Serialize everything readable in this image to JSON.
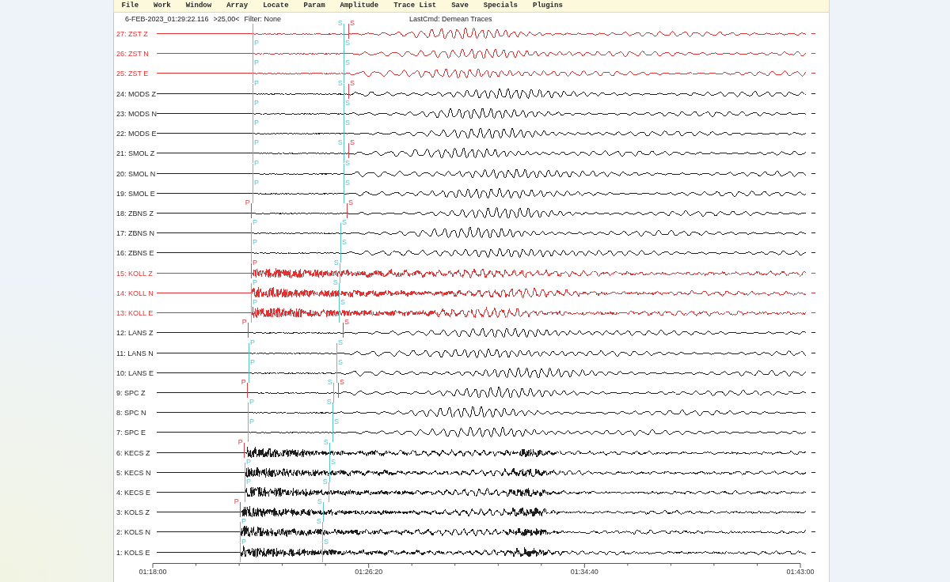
{
  "menu": [
    "File",
    "Work",
    "Window",
    "Array",
    "Locate",
    "Param",
    "Amplitude",
    "Trace List",
    "Save",
    "Specials",
    "Plugins"
  ],
  "header": {
    "event_time": "6-FEB-2023_01:29:22.116",
    "scale": ">25,00<",
    "filter": "Filter: None",
    "last_command": "LastCmd: Demean Traces"
  },
  "traces": [
    {
      "label": "27: ZST Z",
      "color": "#e03232",
      "picks": [
        {
          "kind": "p_theoretical"
        },
        {
          "kind": "s_theoretical",
          "phase": "S"
        },
        {
          "kind": "s_picked",
          "phase": "S"
        }
      ]
    },
    {
      "label": "26: ZST N",
      "color": "#e03232",
      "picks": [
        {
          "kind": "p_theoretical",
          "phase": "P"
        },
        {
          "kind": "s_theoretical",
          "phase": "S"
        }
      ]
    },
    {
      "label": "25: ZST E",
      "color": "#e03232",
      "picks": [
        {
          "kind": "p_theoretical",
          "phase": "P"
        },
        {
          "kind": "s_theoretical",
          "phase": "S"
        }
      ]
    },
    {
      "label": "24: MODS Z",
      "color": "#1e1e1e",
      "picks": [
        {
          "kind": "p_theoretical",
          "phase": "P"
        },
        {
          "kind": "s_theoretical",
          "phase": "S"
        },
        {
          "kind": "s_picked",
          "phase": "S"
        }
      ]
    },
    {
      "label": "23: MODS N",
      "color": "#1e1e1e",
      "picks": [
        {
          "kind": "p_theoretical",
          "phase": "P"
        },
        {
          "kind": "s_theoretical",
          "phase": "S"
        }
      ]
    },
    {
      "label": "22: MODS E",
      "color": "#1e1e1e",
      "picks": [
        {
          "kind": "p_theoretical",
          "phase": "P"
        },
        {
          "kind": "s_theoretical",
          "phase": "S"
        }
      ]
    },
    {
      "label": "21: SMOL Z",
      "color": "#1e1e1e",
      "picks": [
        {
          "kind": "p_theoretical",
          "phase": "P"
        },
        {
          "kind": "s_theoretical",
          "phase": "S"
        },
        {
          "kind": "s_picked",
          "phase": "S"
        }
      ]
    },
    {
      "label": "20: SMOL N",
      "color": "#1e1e1e",
      "picks": [
        {
          "kind": "p_theoretical",
          "phase": "P"
        },
        {
          "kind": "s_theoretical",
          "phase": "S"
        }
      ]
    },
    {
      "label": "19: SMOL E",
      "color": "#1e1e1e",
      "picks": [
        {
          "kind": "p_theoretical",
          "phase": "P"
        },
        {
          "kind": "s_theoretical",
          "phase": "S"
        }
      ]
    },
    {
      "label": "18: ZBNS Z",
      "color": "#1e1e1e",
      "picks": [
        {
          "kind": "p_picked",
          "phase": "P"
        },
        {
          "kind": "s_picked",
          "phase": "S"
        }
      ]
    },
    {
      "label": "17: ZBNS N",
      "color": "#1e1e1e",
      "picks": [
        {
          "kind": "p_theoretical",
          "phase": "P"
        },
        {
          "kind": "s_theoretical",
          "phase": "S"
        }
      ]
    },
    {
      "label": "16: ZBNS E",
      "color": "#1e1e1e",
      "picks": [
        {
          "kind": "p_theoretical",
          "phase": "P"
        },
        {
          "kind": "s_theoretical",
          "phase": "S"
        }
      ]
    },
    {
      "label": "15: KOLL Z",
      "color": "#e03232",
      "picks": [
        {
          "kind": "p_picked",
          "phase": "P"
        },
        {
          "kind": "s_theoretical",
          "phase": "S"
        }
      ]
    },
    {
      "label": "14: KOLL N",
      "color": "#e03232",
      "picks": [
        {
          "kind": "p_theoretical",
          "phase": "P"
        },
        {
          "kind": "s_theoretical",
          "phase": "S"
        }
      ]
    },
    {
      "label": "13: KOLL E",
      "color": "#e03232",
      "picks": [
        {
          "kind": "p_theoretical",
          "phase": "P"
        },
        {
          "kind": "s_theoretical",
          "phase": "S"
        }
      ]
    },
    {
      "label": "12: LANS Z",
      "color": "#1e1e1e",
      "picks": [
        {
          "kind": "p_picked",
          "phase": "P"
        },
        {
          "kind": "s_picked",
          "phase": "S"
        }
      ]
    },
    {
      "label": "11: LANS N",
      "color": "#1e1e1e",
      "picks": [
        {
          "kind": "p_theoretical",
          "phase": "P"
        },
        {
          "kind": "s_theoretical",
          "phase": "S"
        }
      ]
    },
    {
      "label": "10: LANS E",
      "color": "#1e1e1e",
      "picks": [
        {
          "kind": "p_theoretical",
          "phase": "P"
        },
        {
          "kind": "s_theoretical",
          "phase": "S"
        }
      ]
    },
    {
      "label": "9: SPC Z",
      "color": "#1e1e1e",
      "picks": [
        {
          "kind": "p_picked",
          "phase": "P"
        },
        {
          "kind": "s_theoretical",
          "phase": "S"
        },
        {
          "kind": "s_picked",
          "phase": "S"
        }
      ]
    },
    {
      "label": "8: SPC N",
      "color": "#1e1e1e",
      "picks": [
        {
          "kind": "p_theoretical",
          "phase": "P"
        },
        {
          "kind": "s_theoretical",
          "phase": "S"
        }
      ]
    },
    {
      "label": "7: SPC E",
      "color": "#1e1e1e",
      "picks": [
        {
          "kind": "p_theoretical",
          "phase": "P"
        },
        {
          "kind": "s_theoretical",
          "phase": "S"
        }
      ]
    },
    {
      "label": "6: KECS Z",
      "color": "#1e1e1e",
      "picks": [
        {
          "kind": "p_picked",
          "phase": "P"
        },
        {
          "kind": "s_theoretical",
          "phase": "S"
        }
      ]
    },
    {
      "label": "5: KECS N",
      "color": "#1e1e1e",
      "picks": [
        {
          "kind": "p_theoretical",
          "phase": "P"
        },
        {
          "kind": "s_theoretical",
          "phase": "S"
        }
      ]
    },
    {
      "label": "4: KECS E",
      "color": "#1e1e1e",
      "picks": [
        {
          "kind": "p_theoretical",
          "phase": "P"
        },
        {
          "kind": "s_theoretical",
          "phase": "S"
        }
      ]
    },
    {
      "label": "3: KOLS Z",
      "color": "#1e1e1e",
      "picks": [
        {
          "kind": "p_picked",
          "phase": "P"
        },
        {
          "kind": "s_theoretical",
          "phase": "S"
        }
      ]
    },
    {
      "label": "2: KOLS N",
      "color": "#1e1e1e",
      "picks": [
        {
          "kind": "p_theoretical",
          "phase": "P"
        },
        {
          "kind": "s_theoretical",
          "phase": "S"
        }
      ]
    },
    {
      "label": "1: KOLS E",
      "color": "#1e1e1e",
      "picks": [
        {
          "kind": "p_theoretical",
          "phase": "P"
        },
        {
          "kind": "s_theoretical",
          "phase": "S"
        }
      ]
    }
  ],
  "time_axis": {
    "labels": [
      "01:18:00",
      "01:26:20",
      "01:34:40",
      "01:43:00"
    ]
  }
}
